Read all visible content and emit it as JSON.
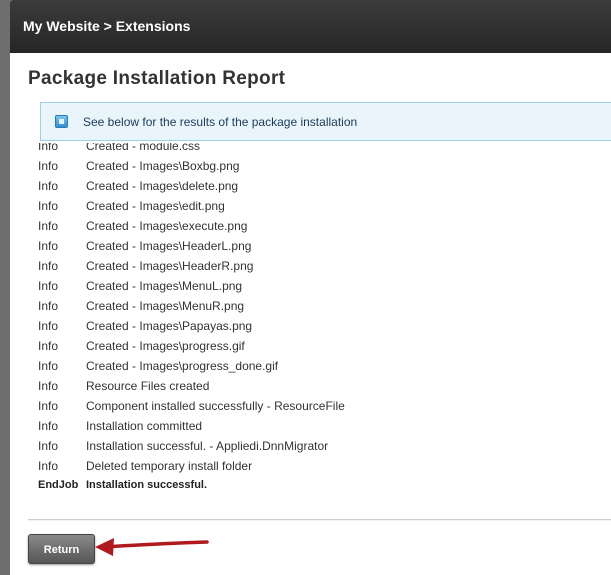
{
  "window": {
    "title": "My Website > Extensions"
  },
  "report": {
    "heading": "Package Installation Report"
  },
  "notice": {
    "icon": "info-icon",
    "message": "See below for the results of the package installation"
  },
  "log": [
    {
      "level": "Info",
      "message": "Created - module.css"
    },
    {
      "level": "Info",
      "message": "Created - Images\\Boxbg.png"
    },
    {
      "level": "Info",
      "message": "Created - Images\\delete.png"
    },
    {
      "level": "Info",
      "message": "Created - Images\\edit.png"
    },
    {
      "level": "Info",
      "message": "Created - Images\\execute.png"
    },
    {
      "level": "Info",
      "message": "Created - Images\\HeaderL.png"
    },
    {
      "level": "Info",
      "message": "Created - Images\\HeaderR.png"
    },
    {
      "level": "Info",
      "message": "Created - Images\\MenuL.png"
    },
    {
      "level": "Info",
      "message": "Created - Images\\MenuR.png"
    },
    {
      "level": "Info",
      "message": "Created - Images\\Papayas.png"
    },
    {
      "level": "Info",
      "message": "Created - Images\\progress.gif"
    },
    {
      "level": "Info",
      "message": "Created - Images\\progress_done.gif"
    },
    {
      "level": "Info",
      "message": "Resource Files created"
    },
    {
      "level": "Info",
      "message": "Component installed successfully - ResourceFile"
    },
    {
      "level": "Info",
      "message": "Installation committed"
    },
    {
      "level": "Info",
      "message": "Installation successful. - Appliedi.DnnMigrator"
    },
    {
      "level": "Info",
      "message": "Deleted temporary install folder"
    },
    {
      "level": "EndJob",
      "message": "Installation successful."
    }
  ],
  "footer": {
    "return_label": "Return"
  },
  "colors": {
    "arrow": "#b0191e",
    "titlebar": "#2e2e2e",
    "notice_bg": "#eaf5fb"
  }
}
